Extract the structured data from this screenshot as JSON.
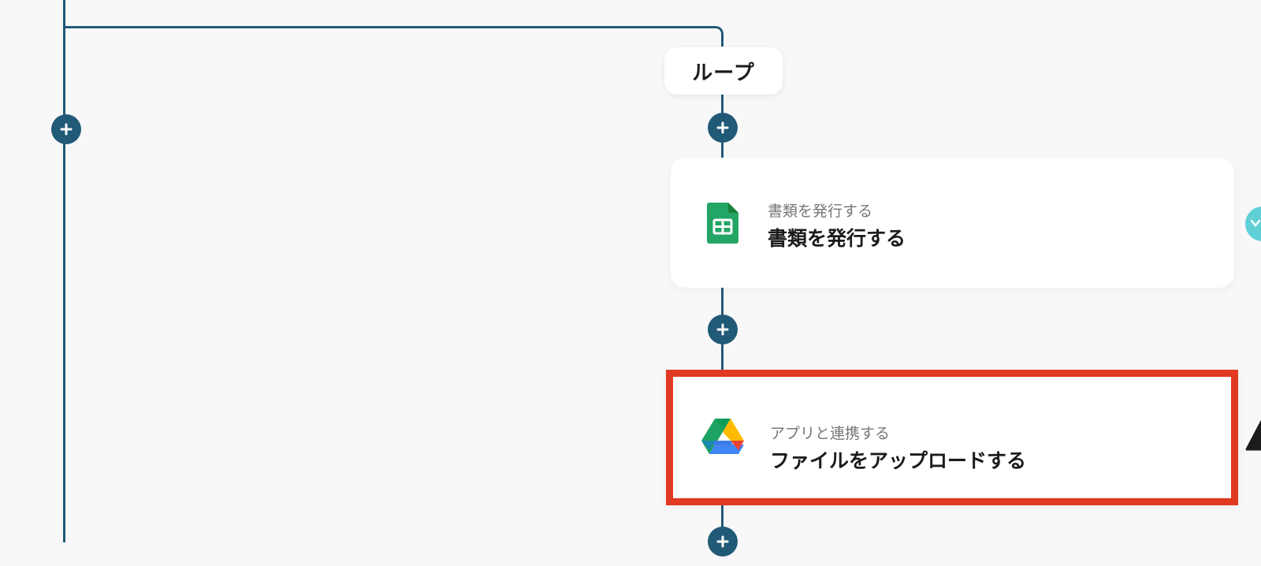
{
  "flow": {
    "loop_label": "ループ",
    "steps": [
      {
        "subtitle": "書類を発行する",
        "title": "書類を発行する",
        "icon": "google-sheets-icon"
      },
      {
        "subtitle": "アプリと連携する",
        "title": "ファイルをアップロードする",
        "icon": "google-drive-icon",
        "highlighted": true
      }
    ]
  },
  "colors": {
    "connector": "#215a77",
    "highlight": "#e03a23",
    "background": "#f8f8f9",
    "handle": "#5fcfd6"
  },
  "icons": {
    "add": "plus-icon",
    "handle": "chevron-down-icon",
    "warning": "warning-triangle-icon"
  }
}
